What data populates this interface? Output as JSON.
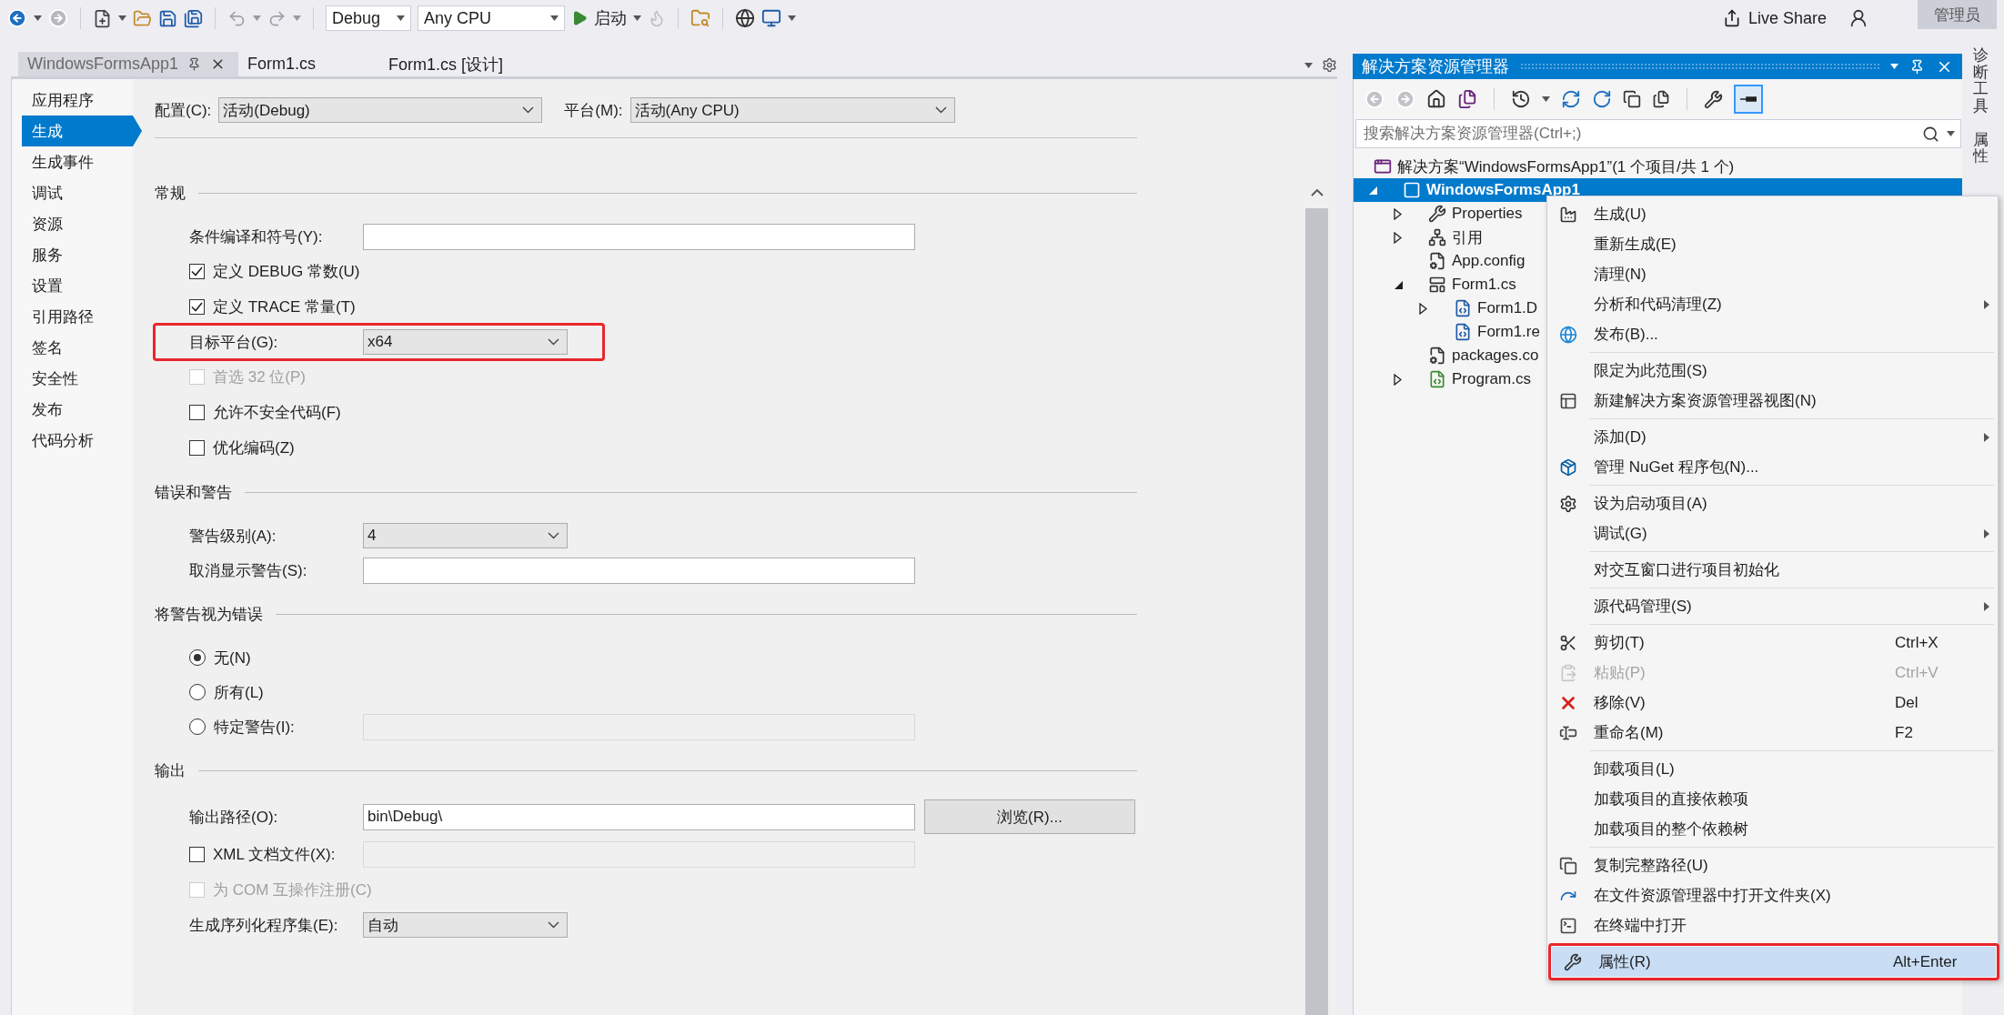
{
  "toolbar": {
    "configuration": "Debug",
    "platform": "Any CPU",
    "start": "启动",
    "live_share": "Live Share",
    "account": "管理员"
  },
  "document_tabs": [
    {
      "label": "WindowsFormsApp1",
      "selected": true
    },
    {
      "label": "Form1.cs",
      "selected": false
    },
    {
      "label": "Form1.cs [设计]",
      "selected": false
    }
  ],
  "nav": [
    {
      "label": "应用程序",
      "selected": false
    },
    {
      "label": "生成",
      "selected": true
    },
    {
      "label": "生成事件",
      "selected": false
    },
    {
      "label": "调试",
      "selected": false
    },
    {
      "label": "资源",
      "selected": false
    },
    {
      "label": "服务",
      "selected": false
    },
    {
      "label": "设置",
      "selected": false
    },
    {
      "label": "引用路径",
      "selected": false
    },
    {
      "label": "签名",
      "selected": false
    },
    {
      "label": "安全性",
      "selected": false
    },
    {
      "label": "发布",
      "selected": false
    },
    {
      "label": "代码分析",
      "selected": false
    }
  ],
  "config_bar": {
    "configuration_label": "配置(C):",
    "configuration": "活动(Debug)",
    "platform_label": "平台(M):",
    "platform": "活动(Any CPU)"
  },
  "sections": [
    {
      "title": "常规",
      "rows": [
        {
          "kind": "text",
          "label": "条件编译和符号(Y):"
        },
        {
          "kind": "check",
          "label": "定义 DEBUG 常数(U)",
          "checked": true,
          "disabled": false
        },
        {
          "kind": "check",
          "label": "定义 TRACE 常量(T)",
          "checked": true,
          "disabled": false
        },
        {
          "kind": "select",
          "label": "目标平台(G):",
          "value": "x64",
          "annotated": true
        },
        {
          "kind": "check",
          "label": "首选 32 位(P)",
          "checked": false,
          "disabled": true
        },
        {
          "kind": "check",
          "label": "允许不安全代码(F)",
          "checked": false,
          "disabled": false
        },
        {
          "kind": "check",
          "label": "优化编码(Z)",
          "checked": false,
          "disabled": false
        }
      ]
    },
    {
      "title": "错误和警告",
      "rows": [
        {
          "kind": "select",
          "label": "警告级别(A):",
          "value": "4"
        },
        {
          "kind": "text",
          "label": "取消显示警告(S):"
        }
      ]
    },
    {
      "title": "将警告视为错误",
      "rows": [
        {
          "kind": "radio",
          "label": "无(N)",
          "selected": true
        },
        {
          "kind": "radio",
          "label": "所有(L)",
          "selected": false
        },
        {
          "kind": "radio",
          "label": "特定警告(I):",
          "selected": false,
          "field_disabled": true
        }
      ]
    },
    {
      "title": "输出",
      "rows": [
        {
          "kind": "text",
          "label": "输出路径(O):",
          "value": "bin\\Debug\\",
          "button": "浏览(R)..."
        },
        {
          "kind": "check",
          "label": "XML 文档文件(X):",
          "checked": false,
          "disabled": false,
          "field_disabled": true
        },
        {
          "kind": "check",
          "label": "为 COM 互操作注册(C)",
          "checked": false,
          "disabled": true
        },
        {
          "kind": "select",
          "label": "生成序列化程序集(E):",
          "value": "自动"
        }
      ]
    }
  ],
  "solution_explorer": {
    "title": "解决方案资源管理器",
    "preview_on": true,
    "search_placeholder": "搜索解决方案资源管理器(Ctrl+;)",
    "tree": {
      "kind": "solution",
      "label": "解决方案“WindowsFormsApp1”(1 个项目/共 1 个)",
      "selected": false,
      "children": [
        {
          "kind": "project",
          "label": "WindowsFormsApp1",
          "selected": true,
          "expanded": true,
          "children": [
            {
              "kind": "properties",
              "label": "Properties",
              "selected": false,
              "expanded": false
            },
            {
              "kind": "references",
              "label": "引用",
              "selected": false,
              "expanded": false
            },
            {
              "kind": "config",
              "label": "App.config",
              "selected": false
            },
            {
              "kind": "form",
              "label": "Form1.cs",
              "selected": false,
              "expanded": true,
              "children": [
                {
                  "kind": "code",
                  "label": "Form1.D",
                  "selected": false,
                  "expanded": false
                },
                {
                  "kind": "code",
                  "label": "Form1.re",
                  "selected": false
                }
              ]
            },
            {
              "kind": "config",
              "label": "packages.co",
              "selected": false
            },
            {
              "kind": "csharp",
              "label": "Program.cs",
              "selected": false,
              "expanded": false
            }
          ]
        }
      ]
    }
  },
  "vertical_tabs": [
    "诊断工具",
    "属性"
  ],
  "context_menu": [
    [
      {
        "label": "生成(U)",
        "selected": false,
        "disabled": false
      },
      {
        "label": "重新生成(E)",
        "selected": false,
        "disabled": false
      },
      {
        "label": "清理(N)",
        "selected": false,
        "disabled": false
      },
      {
        "label": "分析和代码清理(Z)",
        "selected": false,
        "disabled": false,
        "submenu": true
      },
      {
        "label": "发布(B)...",
        "selected": false,
        "disabled": false
      }
    ],
    [
      {
        "label": "限定为此范围(S)",
        "selected": false,
        "disabled": false
      },
      {
        "label": "新建解决方案资源管理器视图(N)",
        "selected": false,
        "disabled": false
      }
    ],
    [
      {
        "label": "添加(D)",
        "selected": false,
        "disabled": false,
        "submenu": true
      },
      {
        "label": "管理 NuGet 程序包(N)...",
        "selected": false,
        "disabled": false
      }
    ],
    [
      {
        "label": "设为启动项目(A)",
        "selected": false,
        "disabled": false
      },
      {
        "label": "调试(G)",
        "selected": false,
        "disabled": false,
        "submenu": true
      }
    ],
    [
      {
        "label": "对交互窗口进行项目初始化",
        "selected": false,
        "disabled": false
      }
    ],
    [
      {
        "label": "源代码管理(S)",
        "selected": false,
        "disabled": false,
        "submenu": true
      }
    ],
    [
      {
        "label": "剪切(T)",
        "shortcut": "Ctrl+X",
        "selected": false,
        "disabled": false
      },
      {
        "label": "粘贴(P)",
        "shortcut": "Ctrl+V",
        "selected": false,
        "disabled": true
      },
      {
        "label": "移除(V)",
        "shortcut": "Del",
        "selected": false,
        "disabled": false
      },
      {
        "label": "重命名(M)",
        "shortcut": "F2",
        "selected": false,
        "disabled": false
      }
    ],
    [
      {
        "label": "卸载项目(L)",
        "selected": false,
        "disabled": false
      },
      {
        "label": "加载项目的直接依赖项",
        "selected": false,
        "disabled": false
      },
      {
        "label": "加载项目的整个依赖树",
        "selected": false,
        "disabled": false
      }
    ],
    [
      {
        "label": "复制完整路径(U)",
        "selected": false,
        "disabled": false
      },
      {
        "label": "在文件资源管理器中打开文件夹(X)",
        "selected": false,
        "disabled": false
      },
      {
        "label": "在终端中打开",
        "selected": false,
        "disabled": false
      }
    ],
    [
      {
        "label": "属性(R)",
        "shortcut": "Alt+Enter",
        "selected": true,
        "disabled": false,
        "annotated": true
      }
    ]
  ]
}
